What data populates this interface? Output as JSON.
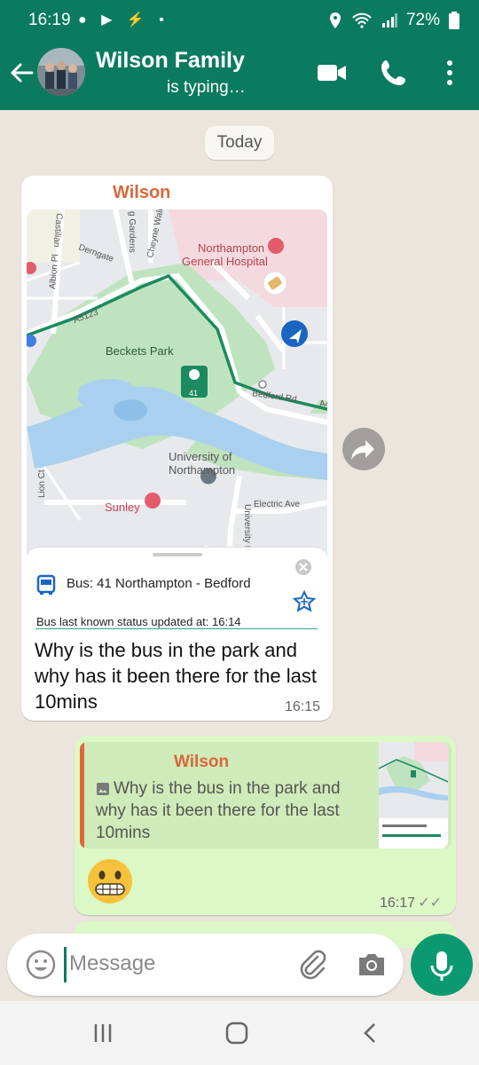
{
  "status_bar": {
    "time": "16:19",
    "battery": "72%"
  },
  "header": {
    "title": "Wilson Family",
    "subtitle": "is typing…"
  },
  "date_chip": "Today",
  "incoming_message": {
    "sender": "Wilson",
    "map": {
      "labels": {
        "hospital": "Northampton General Hospital",
        "park": "Beckets Park",
        "route": "A5123",
        "road1": "Bedford Rd",
        "road2": "A4",
        "university": "University of Northampton",
        "hotel": "Sunley",
        "electric": "Electric Ave",
        "derngate": "Derngate",
        "cheyne": "Cheyne Walk",
        "albion": "Albion Pl",
        "lion": "Lion Ct",
        "uni_dr": "University Dr",
        "gardens": "g Gardens",
        "castillian": "Castilian",
        "bus_number": "41"
      }
    },
    "bus_card": {
      "name": "Bus: 41 Northampton - Bedford",
      "status": "Bus last known status updated at: 16:14"
    },
    "text": "Why is the bus in the park and why has it been there for the last 10mins",
    "time": "16:15"
  },
  "outgoing_message": {
    "quote_sender": "Wilson",
    "quote_text": "Why is the bus in the park and why has it been there for the last 10mins",
    "time": "16:17"
  },
  "input": {
    "placeholder": "Message"
  }
}
